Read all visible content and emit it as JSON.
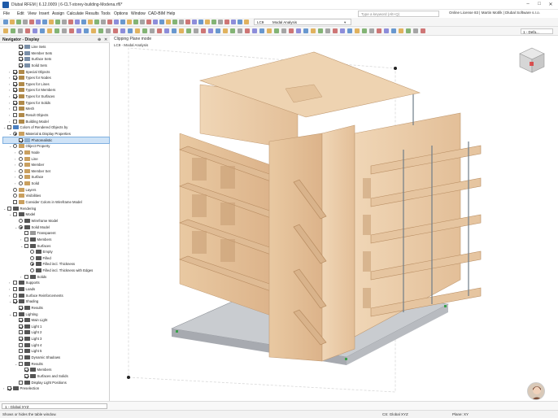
{
  "window": {
    "title": "Dlubal RFEM | 6.12.0009 | 6-CLT-storey-building-Modena.rf6*",
    "minimize_icon": "minimize-icon",
    "maximize_icon": "maximize-icon",
    "close_icon": "close-icon"
  },
  "menu": [
    "File",
    "Edit",
    "View",
    "Insert",
    "Assign",
    "Calculate",
    "Results",
    "Tools",
    "Options",
    "Window",
    "CAD-BIM",
    "Help"
  ],
  "search": {
    "placeholder": "Type a keyword (Alt+Q)"
  },
  "license": "Online License 83 | Martin Motlík | Dlubal Software s.r.o.",
  "loadcase": {
    "code": "LC9",
    "name": "Modal Analysis"
  },
  "view_combo": "1 - Defa...",
  "navigator": {
    "title": "Navigator - Display",
    "items": [
      {
        "label": "Line Sets",
        "indent": 2,
        "check": "on",
        "icon": "#7a8fa8"
      },
      {
        "label": "Member Sets",
        "indent": 2,
        "check": "on",
        "icon": "#7a8fa8"
      },
      {
        "label": "Surface Sets",
        "indent": 2,
        "check": "on",
        "icon": "#7a8fa8"
      },
      {
        "label": "Solid Sets",
        "indent": 2,
        "check": "on",
        "icon": "#7a8fa8"
      },
      {
        "label": "Special Objects",
        "indent": 1,
        "check": "on",
        "icon": "#b08a4a",
        "ex": "›"
      },
      {
        "label": "Types for Nodes",
        "indent": 1,
        "check": "on",
        "icon": "#b08a4a",
        "ex": "›"
      },
      {
        "label": "Types for Lines",
        "indent": 1,
        "check": "on",
        "icon": "#b08a4a",
        "ex": "›"
      },
      {
        "label": "Types for Members",
        "indent": 1,
        "check": "on",
        "icon": "#b08a4a",
        "ex": "›"
      },
      {
        "label": "Types for Surfaces",
        "indent": 1,
        "check": "on",
        "icon": "#b08a4a",
        "ex": "›"
      },
      {
        "label": "Types for Solids",
        "indent": 1,
        "check": "on",
        "icon": "#b08a4a",
        "ex": "›"
      },
      {
        "label": "Mesh",
        "indent": 1,
        "check": "off",
        "icon": "#b08a4a",
        "ex": "›"
      },
      {
        "label": "Result Objects",
        "indent": 1,
        "check": "off",
        "icon": "#b08a4a",
        "ex": "›"
      },
      {
        "label": "Building Model",
        "indent": 1,
        "check": "off",
        "icon": "#b08a4a",
        "ex": "›"
      },
      {
        "label": "Colors of Rendered Objects by",
        "indent": 0,
        "check": "off",
        "icon": "#4a7fc0",
        "ex": "⌄"
      },
      {
        "label": "Material & Display Properties",
        "indent": 1,
        "radio": "on",
        "icon": "#c9a060",
        "ex": "⌄"
      },
      {
        "label": "Photorealistic",
        "indent": 2,
        "check": "on",
        "icon": "#8fb0d0",
        "selected": true
      },
      {
        "label": "Object Property",
        "indent": 1,
        "radio": "off",
        "icon": "#c9a060",
        "ex": "⌄"
      },
      {
        "label": "Node",
        "indent": 2,
        "radio": "off",
        "icon": "#c9a060",
        "ex": "›"
      },
      {
        "label": "Line",
        "indent": 2,
        "radio": "off",
        "icon": "#c9a060",
        "ex": "›"
      },
      {
        "label": "Member",
        "indent": 2,
        "radio": "off",
        "icon": "#c9a060",
        "ex": "›"
      },
      {
        "label": "Member Set",
        "indent": 2,
        "radio": "off",
        "icon": "#c9a060",
        "ex": "›"
      },
      {
        "label": "Surface",
        "indent": 2,
        "radio": "off",
        "icon": "#c9a060",
        "ex": "›"
      },
      {
        "label": "Solid",
        "indent": 2,
        "radio": "off",
        "icon": "#c9a060",
        "ex": "›"
      },
      {
        "label": "Layers",
        "indent": 1,
        "radio": "off",
        "icon": "#c9a060"
      },
      {
        "label": "Visibilities",
        "indent": 1,
        "radio": "off",
        "icon": "#c9a060"
      },
      {
        "label": "Consider Colors in Wireframe Model",
        "indent": 1,
        "check": "off",
        "icon": "#c9a060"
      },
      {
        "label": "Rendering",
        "indent": 0,
        "check": "off",
        "icon": "#555",
        "ex": "⌄"
      },
      {
        "label": "Model",
        "indent": 1,
        "check": "off",
        "icon": "#555",
        "ex": "⌄"
      },
      {
        "label": "Wireframe Model",
        "indent": 2,
        "radio": "off",
        "icon": "#555"
      },
      {
        "label": "Solid Model",
        "indent": 2,
        "radio": "on",
        "icon": "#555",
        "ex": "⌄"
      },
      {
        "label": "Transparent",
        "indent": 3,
        "check": "off",
        "icon": "#999"
      },
      {
        "label": "Members",
        "indent": 3,
        "check": "off",
        "icon": "#555",
        "ex": "›"
      },
      {
        "label": "Surfaces",
        "indent": 3,
        "check": "off",
        "icon": "#555",
        "ex": "⌄"
      },
      {
        "label": "Empty",
        "indent": 4,
        "radio": "off",
        "icon": "#555"
      },
      {
        "label": "Filled",
        "indent": 4,
        "radio": "off",
        "icon": "#555"
      },
      {
        "label": "Filled incl. Thickness",
        "indent": 4,
        "radio": "on",
        "icon": "#555"
      },
      {
        "label": "Filled incl. Thickness with Edges",
        "indent": 4,
        "radio": "off",
        "icon": "#555"
      },
      {
        "label": "Solids",
        "indent": 3,
        "check": "off",
        "icon": "#555",
        "ex": "›"
      },
      {
        "label": "Supports",
        "indent": 1,
        "check": "off",
        "icon": "#555",
        "ex": "›"
      },
      {
        "label": "Loads",
        "indent": 1,
        "check": "off",
        "icon": "#555",
        "ex": "›"
      },
      {
        "label": "Surface Reinforcements",
        "indent": 1,
        "check": "off",
        "icon": "#555",
        "ex": "›"
      },
      {
        "label": "Shading",
        "indent": 1,
        "check": "on",
        "icon": "#555",
        "ex": "⌄"
      },
      {
        "label": "Results",
        "indent": 2,
        "check": "on",
        "icon": "#555"
      },
      {
        "label": "Lighting",
        "indent": 1,
        "check": "off",
        "icon": "#555",
        "ex": "⌄"
      },
      {
        "label": "Main Light",
        "indent": 2,
        "check": "on",
        "icon": "#555"
      },
      {
        "label": "Light 1",
        "indent": 2,
        "check": "on",
        "icon": "#555"
      },
      {
        "label": "Light 2",
        "indent": 2,
        "check": "off",
        "icon": "#555"
      },
      {
        "label": "Light 3",
        "indent": 2,
        "check": "on",
        "icon": "#555"
      },
      {
        "label": "Light 4",
        "indent": 2,
        "check": "off",
        "icon": "#555"
      },
      {
        "label": "Light 5",
        "indent": 2,
        "check": "off",
        "icon": "#555"
      },
      {
        "label": "Dynamic Shadows",
        "indent": 2,
        "check": "off",
        "icon": "#555"
      },
      {
        "label": "Results",
        "indent": 2,
        "check": "off",
        "icon": "#555",
        "ex": "⌄"
      },
      {
        "label": "Members",
        "indent": 3,
        "check": "on",
        "icon": "#555"
      },
      {
        "label": "Surfaces and Solids",
        "indent": 3,
        "check": "on",
        "icon": "#555"
      },
      {
        "label": "Display Light Positions",
        "indent": 2,
        "check": "off",
        "icon": "#555"
      },
      {
        "label": "Preselection",
        "indent": 0,
        "check": "on",
        "icon": "#555",
        "ex": "›"
      }
    ]
  },
  "viewport": {
    "label1": "Clipping Plane mode",
    "label2": "LC9 - Modal Analysis"
  },
  "bottom": {
    "view": "1 - Global XYZ"
  },
  "status": {
    "left": "Shows or hides the table window.",
    "cs": "CS: Global XYZ",
    "plane": "Plane: XY"
  },
  "colors": {
    "accent": "#1e5aa8",
    "selection": "#cfe3f7",
    "timber": "#e8c9a5"
  }
}
